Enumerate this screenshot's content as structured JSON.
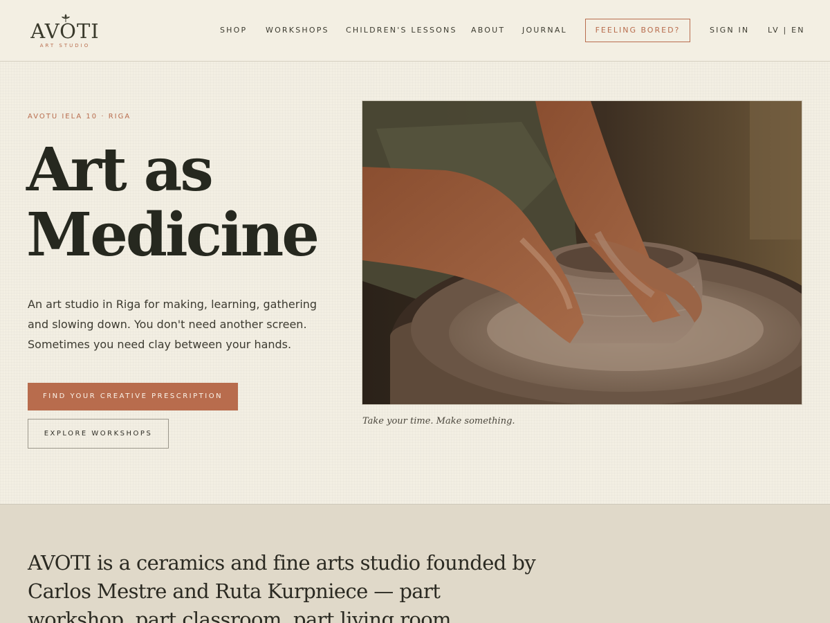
{
  "brand": {
    "name": "AVOTI",
    "tagline": "ART STUDIO"
  },
  "nav": {
    "items": [
      {
        "key": "shop",
        "label": "SHOP"
      },
      {
        "key": "workshops",
        "label": "WORKSHOPS"
      },
      {
        "key": "childrens-lessons",
        "label": "CHILDREN'S LESSONS"
      },
      {
        "key": "about",
        "label": "ABOUT"
      },
      {
        "key": "journal",
        "label": "JOURNAL"
      }
    ],
    "cta_label": "FEELING BORED?",
    "sign_in": "SIGN IN",
    "language": "LV | EN"
  },
  "hero": {
    "eyebrow": "AVOTU IELA 10 · RIGA",
    "headline_line1": "Art as",
    "headline_line2": "Medicine",
    "intro": "An art studio in Riga for making, learning, gathering and slowing down. You don't need another screen. Sometimes you need clay between your hands.",
    "primary_button": "FIND YOUR CREATIVE PRESCRIPTION",
    "secondary_button": "EXPLORE WORKSHOPS",
    "caption": "Take your time. Make something."
  },
  "about": {
    "text": "AVOTI is a ceramics and fine arts studio founded by Carlos Mestre and Ruta Kurpniece — part workshop, part classroom, part living room."
  },
  "colors": {
    "background": "#f3efe3",
    "accent": "#b86c4d",
    "text": "#26281f",
    "about_background": "#e0d9c9"
  }
}
